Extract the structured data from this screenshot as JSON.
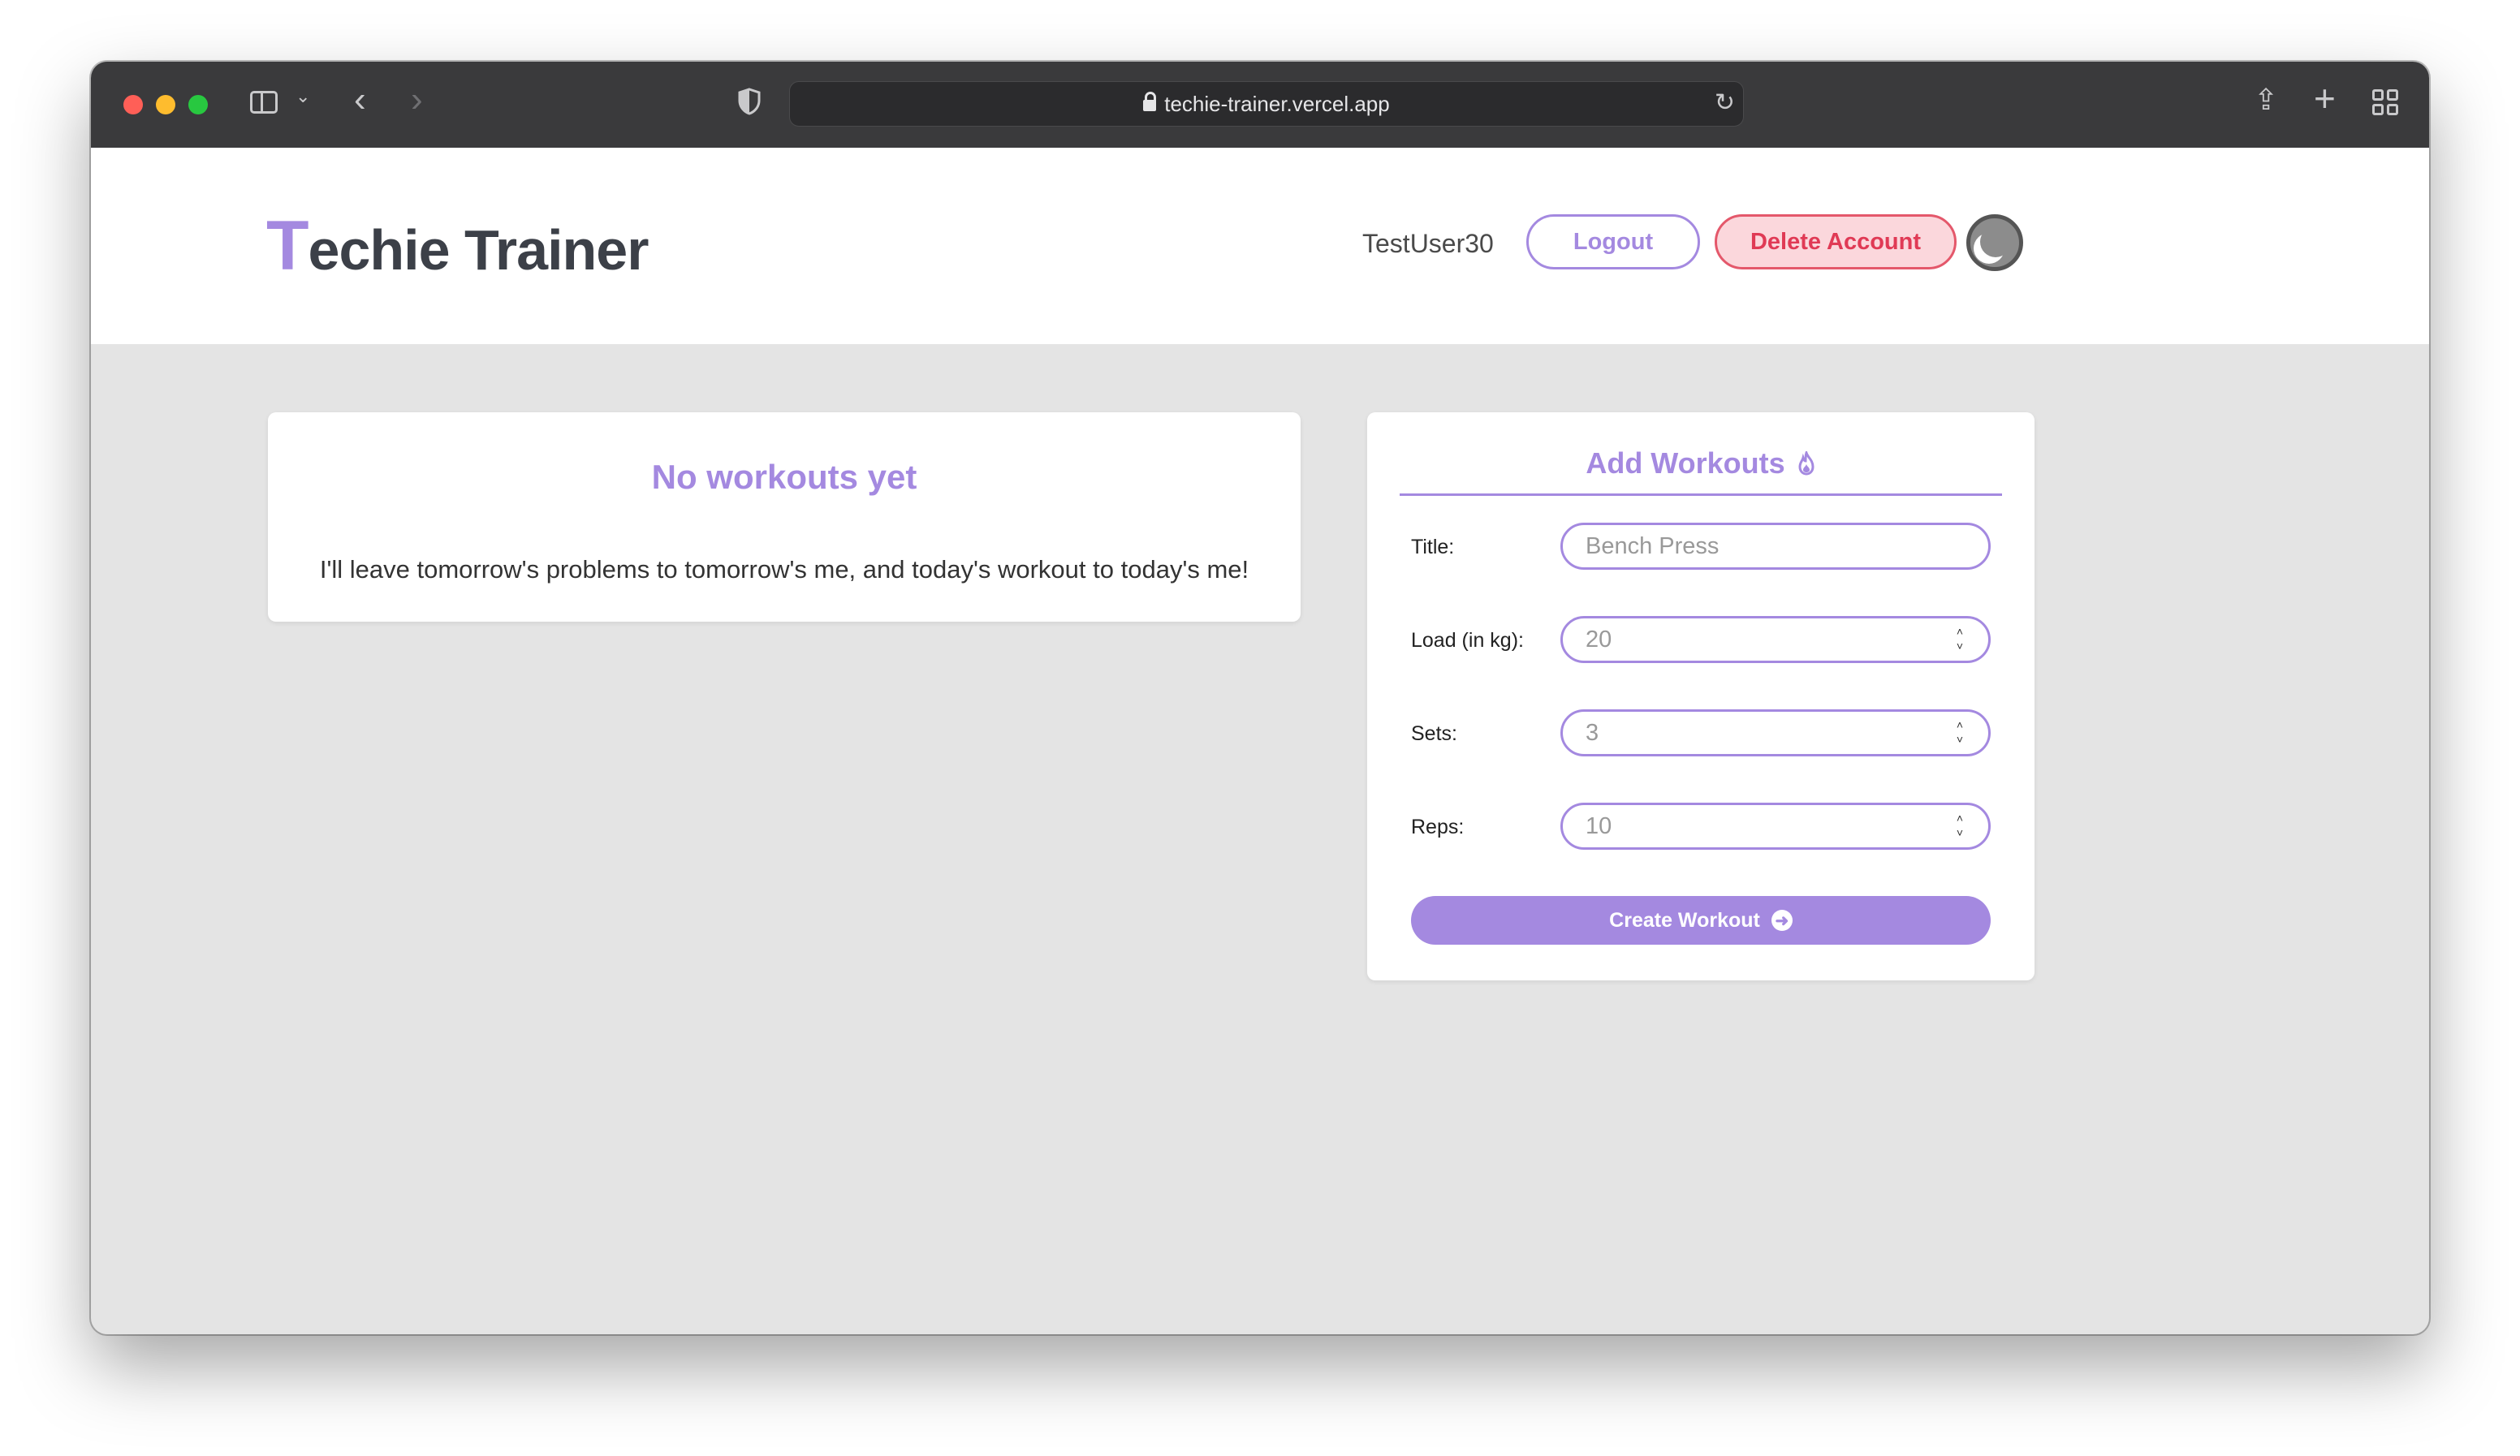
{
  "browser": {
    "url": "techie-trainer.vercel.app",
    "icons": [
      "sidebar-icon",
      "chevron-down-icon",
      "back-icon",
      "forward-icon",
      "shield-icon",
      "lock-icon",
      "reload-icon",
      "share-icon",
      "plus-icon",
      "tab-overview-icon"
    ]
  },
  "header": {
    "logo_initial": "T",
    "logo_rest": "echie Trainer",
    "username": "TestUser30",
    "logout_label": "Logout",
    "delete_label": "Delete Account",
    "theme_icon": "moon-icon"
  },
  "workouts": {
    "empty_title": "No workouts yet",
    "empty_message": "I'll leave tomorrow's problems to tomorrow's me, and today's workout to today's me!"
  },
  "form": {
    "title": "Add Workouts",
    "title_icon": "fire-icon",
    "fields": [
      {
        "label": "Title:",
        "placeholder": "Bench Press",
        "type": "text"
      },
      {
        "label": "Load (in kg):",
        "placeholder": "20",
        "type": "number"
      },
      {
        "label": "Sets:",
        "placeholder": "3",
        "type": "number"
      },
      {
        "label": "Reps:",
        "placeholder": "10",
        "type": "number"
      }
    ],
    "submit_label": "Create Workout",
    "submit_icon": "arrow-right-circle-icon"
  },
  "colors": {
    "accent": "#a489e0",
    "danger": "#e03a55",
    "danger_bg": "#fbd7dc",
    "page_bg": "#e4e4e4"
  }
}
